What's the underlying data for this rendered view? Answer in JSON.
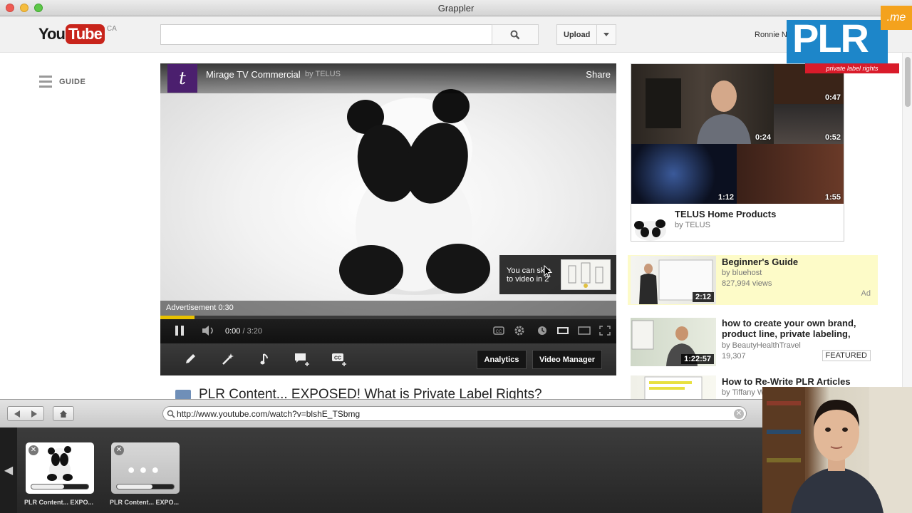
{
  "window": {
    "title": "Grappler"
  },
  "youtube": {
    "logo_you": "You",
    "logo_tube": "Tube",
    "region": "CA",
    "search_placeholder": "",
    "upload_label": "Upload",
    "user_name": "Ronnie N",
    "guide_label": "GUIDE"
  },
  "player": {
    "channel_logo_text": "t",
    "title": "Mirage TV Commercial",
    "by": "by TELUS",
    "share": "Share",
    "skip_text": "You can skip to video in 2",
    "ad_label": "Advertisement 0:30",
    "progress_fraction": 0.075,
    "time_current": "0:00",
    "time_duration": "/ 3:20",
    "analytics_label": "Analytics",
    "video_manager_label": "Video Manager"
  },
  "page": {
    "video_title": "PLR Content... EXPOSED! What is Private Label Rights?"
  },
  "promo": {
    "durations": [
      "0:47",
      "0:24",
      "0:52",
      "1:12",
      "1:55"
    ],
    "title": "TELUS Home Products",
    "by": "by TELUS"
  },
  "related": [
    {
      "title": "Beginner's Guide",
      "by": "by bluehost",
      "views": "827,994 views",
      "duration": "2:12",
      "tag": "Ad"
    },
    {
      "title": "how to create your own brand, product line, private labeling,",
      "by": "by BeautyHealthTravel",
      "views": "19,307",
      "duration": "1:22:57",
      "tag": "FEATURED"
    },
    {
      "title": "How to Re-Write PLR Articles",
      "by": "by Tiffany W",
      "views": "",
      "duration": "",
      "tag": ""
    }
  ],
  "watermark": {
    "brand": "PLR",
    "tagline": "private label rights",
    "tld": ".me"
  },
  "grappler": {
    "url": "http://www.youtube.com/watch?v=blshE_TSbmg",
    "tabs": [
      {
        "label": "PLR Content... EXPO...",
        "progress_fraction": 0.58
      },
      {
        "label": "PLR Content... EXPO...",
        "progress_fraction": 0.63
      }
    ]
  },
  "colors": {
    "youtube_red": "#c8241b",
    "progress_yellow": "#e8c100",
    "plr_blue": "#1d86c9",
    "plr_red": "#d91b2a",
    "ad_bg": "#fdfbc8"
  }
}
